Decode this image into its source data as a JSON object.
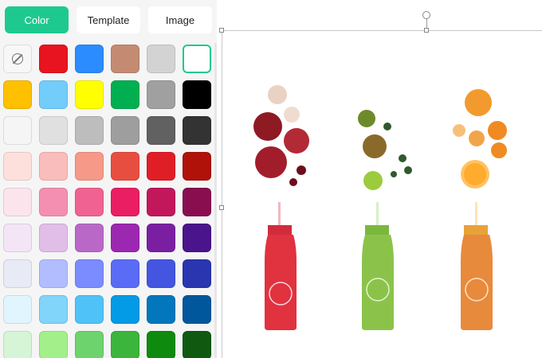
{
  "tabs": [
    {
      "label": "Color",
      "active": true
    },
    {
      "label": "Template",
      "active": false
    },
    {
      "label": "Image",
      "active": false
    }
  ],
  "swatches": [
    [
      "none",
      "#e8141f",
      "#2a8cff",
      "#c48b72",
      "#d3d3d3",
      "#ffffff"
    ],
    [
      "#ffc000",
      "#72cdfb",
      "#ffff00",
      "#00b050",
      "#a0a0a0",
      "#000000"
    ],
    [
      "#f5f5f5",
      "#e0e0e0",
      "#bdbdbd",
      "#9e9e9e",
      "#616161",
      "#333333"
    ],
    [
      "#fde0dc",
      "#f9bdbb",
      "#f69988",
      "#e84e40",
      "#e01e25",
      "#b0120a"
    ],
    [
      "#fce4ec",
      "#f48fb1",
      "#f06292",
      "#e91e63",
      "#c2185b",
      "#880e4f"
    ],
    [
      "#f3e5f5",
      "#e1bee7",
      "#ba68c8",
      "#9c27b0",
      "#7b1fa2",
      "#4a148c"
    ],
    [
      "#e8eaf6",
      "#b2bdff",
      "#7a8cff",
      "#5a6cf5",
      "#4456e0",
      "#2a35b0"
    ],
    [
      "#e1f5fe",
      "#81d4fa",
      "#4fc3f7",
      "#039be5",
      "#0277bd",
      "#01579b"
    ],
    [
      "#d6f5d6",
      "#a3f08a",
      "#6dd36d",
      "#3bb53b",
      "#0e8a0e",
      "#0f5a10"
    ]
  ],
  "selected_swatch": "#ffffff",
  "accent_color": "#1ec98f",
  "icons": {
    "no_color": "no-color-icon",
    "rotate": "rotate-handle-icon"
  },
  "canvas": {
    "image": "juice-bottles-product-photo",
    "bottles": [
      {
        "color": "#e0323f",
        "fruit": "apple"
      },
      {
        "color": "#8bc34a",
        "fruit": "kiwi"
      },
      {
        "color": "#e88a3c",
        "fruit": "orange"
      }
    ]
  }
}
